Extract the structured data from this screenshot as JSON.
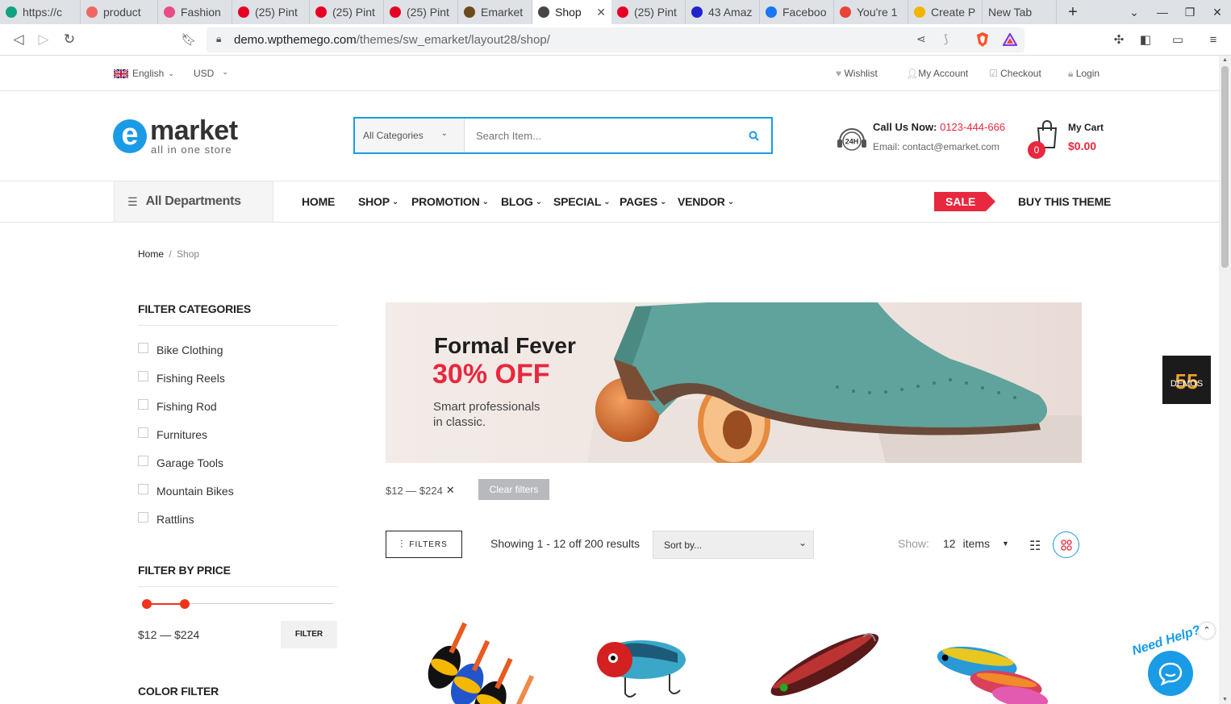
{
  "browser": {
    "tabs": [
      {
        "label": "https://c",
        "icon": "chatgpt-icon",
        "color": "#10a37f"
      },
      {
        "label": "product",
        "icon": "shield-icon",
        "color": "#e66"
      },
      {
        "label": "Fashion",
        "icon": "dribbble-icon",
        "color": "#ea4c89"
      },
      {
        "label": "(25) Pint",
        "icon": "pinterest-icon",
        "color": "#e60023"
      },
      {
        "label": "(25) Pint",
        "icon": "pinterest-icon",
        "color": "#e60023"
      },
      {
        "label": "(25) Pint",
        "icon": "pinterest-icon",
        "color": "#e60023"
      },
      {
        "label": "Emarket",
        "icon": "emarket-icon",
        "color": "#6b4a1e"
      },
      {
        "label": "Shop",
        "icon": "wordpress-icon",
        "color": "#464646",
        "active": true
      },
      {
        "label": "(25) Pint",
        "icon": "pinterest-icon",
        "color": "#e60023"
      },
      {
        "label": "43 Amaz",
        "icon": "circle-icon",
        "color": "#2222cc"
      },
      {
        "label": "Faceboo",
        "icon": "facebook-icon",
        "color": "#1877f2"
      },
      {
        "label": "You're 1",
        "icon": "gmail-icon",
        "color": "#ea4335"
      },
      {
        "label": "Create P",
        "icon": "smile-icon",
        "color": "#f2b400"
      },
      {
        "label": "New Tab",
        "icon": "",
        "color": ""
      }
    ],
    "url_domain": "demo.wpthemego.com",
    "url_path": "/themes/sw_emarket/layout28/shop/"
  },
  "topbar": {
    "language": "English",
    "currency": "USD",
    "links": [
      "Wishlist",
      "My Account",
      "Checkout",
      "Login"
    ]
  },
  "header": {
    "logo_word": "market",
    "logo_letter": "e",
    "logo_tagline": "all in one store",
    "search_category": "All Categories",
    "search_placeholder": "Search Item...",
    "call_label": "Call Us Now:",
    "phone": "0123-444-666",
    "email_line": "Email: contact@emarket.com",
    "hours_badge": "24H",
    "cart_label": "My Cart",
    "cart_total": "$0.00",
    "cart_count": "0"
  },
  "nav": {
    "departments": "All Departments",
    "items": [
      "HOME",
      "SHOP",
      "PROMOTION",
      "BLOG",
      "SPECIAL",
      "PAGES",
      "VENDOR"
    ],
    "sale": "SALE",
    "buy": "BUY THIS THEME"
  },
  "breadcrumb": {
    "home": "Home",
    "sep": "/",
    "current": "Shop"
  },
  "sidebar": {
    "filter_categories": "FILTER CATEGORIES",
    "categories": [
      "Bike Clothing",
      "Fishing Reels",
      "Fishing Rod",
      "Furnitures",
      "Garage Tools",
      "Mountain Bikes",
      "Rattlins"
    ],
    "filter_price": "FILTER BY PRICE",
    "price_range": "$12 — $224",
    "price_min_fraction": 0.0,
    "price_max_fraction": 0.2,
    "filter_button": "FILTER",
    "color_filter": "COLOR FILTER"
  },
  "banner": {
    "title": "Formal Fever",
    "offer": "30% OFF",
    "subtitle_line1": "Smart professionals",
    "subtitle_line2": "in classic."
  },
  "active_filter": {
    "label": "$12 — $224",
    "remove": "✕",
    "clear": "Clear filters"
  },
  "toolbar": {
    "filters_button": "FILTERS",
    "result_count": "Showing 1 - 12 off 200 results",
    "sort_value": "Sort by...",
    "show_label": "Show:",
    "per_page": "12",
    "per_page_unit": "items"
  },
  "floating": {
    "demos_count": "55",
    "demos_label": "DEMOS",
    "need_help": "Need Help?"
  },
  "colors": {
    "accent": "#1a9be6",
    "red": "#e8283e",
    "price_slider": "#f0341c",
    "green_phone": "#e8283e"
  }
}
